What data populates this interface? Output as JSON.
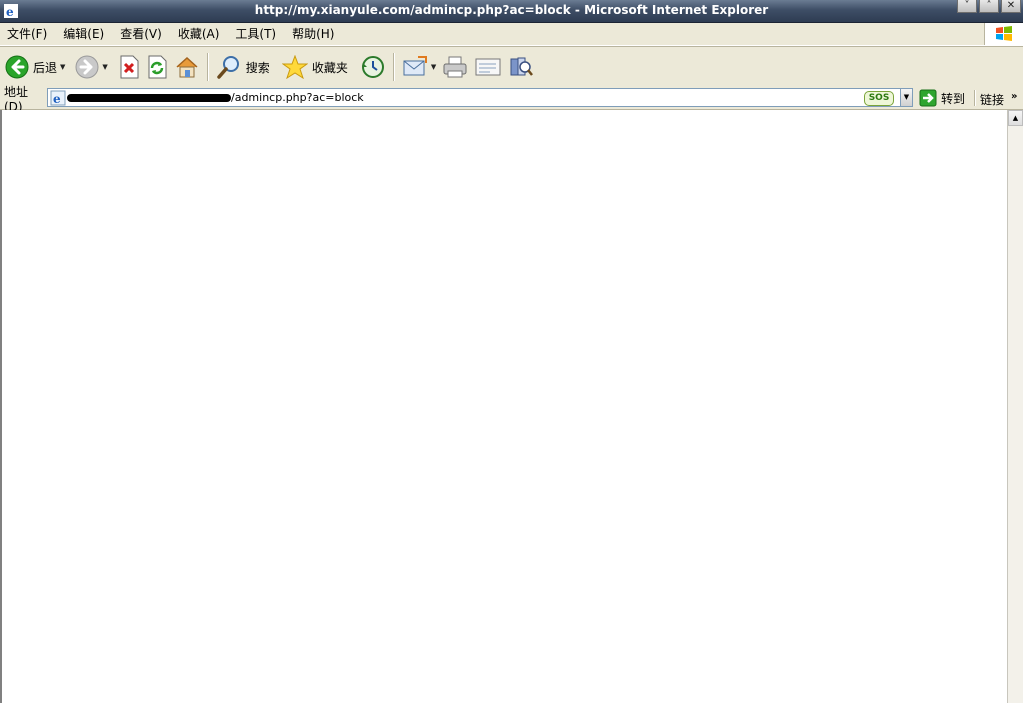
{
  "window": {
    "title": "http://my.xianyule.com/admincp.php?ac=block - Microsoft Internet Explorer",
    "controls": [
      "˅",
      "˄",
      "✕"
    ]
  },
  "menu": [
    "文件(F)",
    "编辑(E)",
    "查看(V)",
    "收藏(A)",
    "工具(T)",
    "帮助(H)"
  ],
  "toolbar": {
    "back_label": "后退",
    "search_label": "搜索",
    "favorites_label": "收藏夹"
  },
  "address": {
    "label": "地址(D)",
    "url_visible": "/admincp.php?ac=block",
    "sos_label": "SOS",
    "go_label": "转到",
    "links_label": "链接",
    "more": "»"
  },
  "colors": {
    "titlebar": "#3e4e66",
    "chrome": "#ece9d8",
    "content": "#ffffff"
  }
}
